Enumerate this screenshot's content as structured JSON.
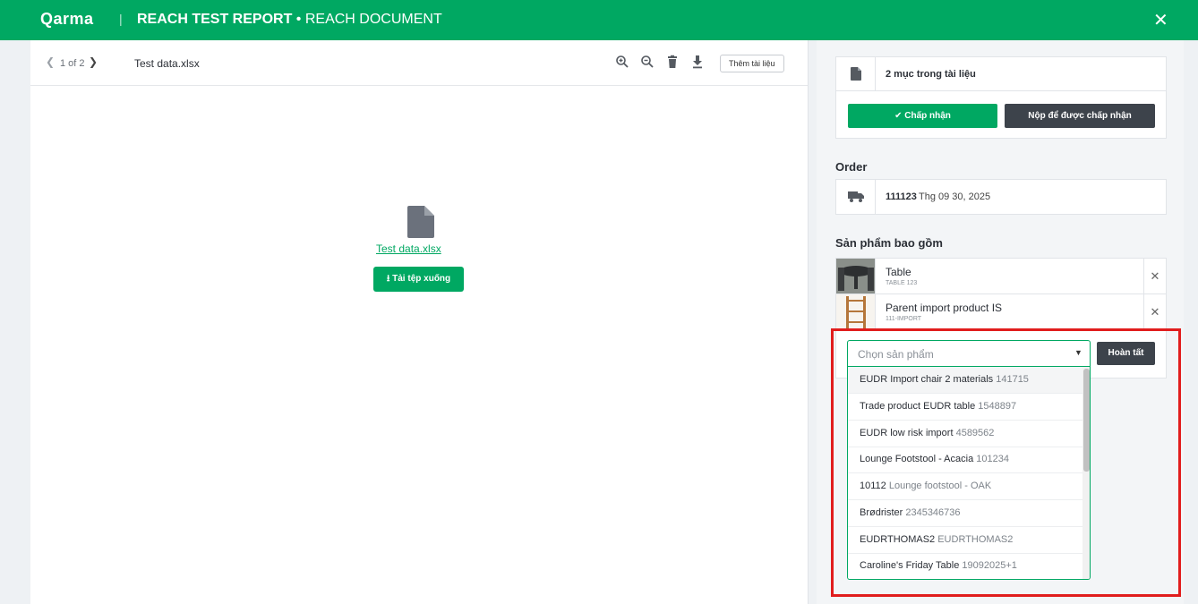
{
  "header": {
    "logo": "Qarma",
    "separator": "|",
    "title_main": "REACH TEST REPORT",
    "title_dot": " • ",
    "title_sub": "REACH DOCUMENT",
    "close": "✕"
  },
  "viewer": {
    "page_count": "1 of 2",
    "file_name": "Test data.xlsx",
    "add_document_label": "Thêm tài liệu",
    "file_link": "Test data.xlsx",
    "download_label": "Tải tệp xuống"
  },
  "documents": {
    "count_label": "2 mục trong tài liệu",
    "accept_label": "Chấp nhận",
    "submit_label": "Nộp để được chấp nhận"
  },
  "order": {
    "heading": "Order",
    "id": "111123",
    "date": "Thg 09 30, 2025"
  },
  "products": {
    "heading": "Sản phẩm bao gồm",
    "items": [
      {
        "name": "Table",
        "code": "TABLE 123"
      },
      {
        "name": "Parent import product IS",
        "code": "111-IMPORT"
      }
    ],
    "select_placeholder": "Chọn sản phẩm",
    "done_label": "Hoàn tất",
    "options": [
      {
        "name": "EUDR Import chair 2 materials",
        "code": "141715"
      },
      {
        "name": "Trade product EUDR table",
        "code": "1548897"
      },
      {
        "name": "EUDR low risk import",
        "code": "4589562"
      },
      {
        "name": "Lounge Footstool - Acacia",
        "code": "101234"
      },
      {
        "name": "10112",
        "code": "Lounge footstool - OAK"
      },
      {
        "name": "Brødrister",
        "code": "2345346736"
      },
      {
        "name": "EUDRTHOMAS2",
        "code": "EUDRTHOMAS2"
      },
      {
        "name": "Caroline's Friday Table",
        "code": "19092025+1"
      }
    ]
  },
  "colors": {
    "brand_green": "#00a862",
    "dark_button": "#3d434b",
    "highlight_red": "#e11d1d"
  }
}
